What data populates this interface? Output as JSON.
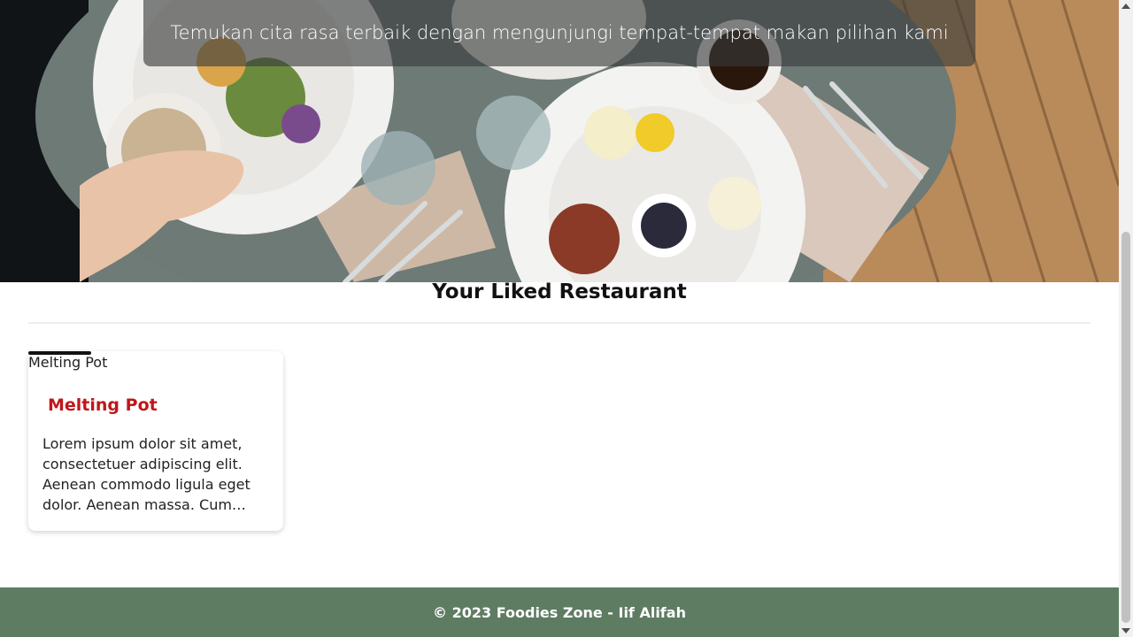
{
  "hero": {
    "tagline": "Temukan cita rasa terbaik dengan mengunjungi tempat-tempat makan pilihan kami"
  },
  "liked_section": {
    "title": "Your Liked Restaurant"
  },
  "restaurants": [
    {
      "image_alt": "Melting Pot",
      "name": "Melting Pot",
      "description": "Lorem ipsum dolor sit amet, consectetuer adipiscing elit. Aenean commodo ligula eget dolor. Aenean massa. Cum sociis natoque penatibus et magnis dis parturient montes."
    }
  ],
  "footer": {
    "text": "© 2023 Foodies Zone - Iif Alifah"
  },
  "colors": {
    "restaurant_name": "#c0161b",
    "footer_bg": "#5e7c62"
  }
}
